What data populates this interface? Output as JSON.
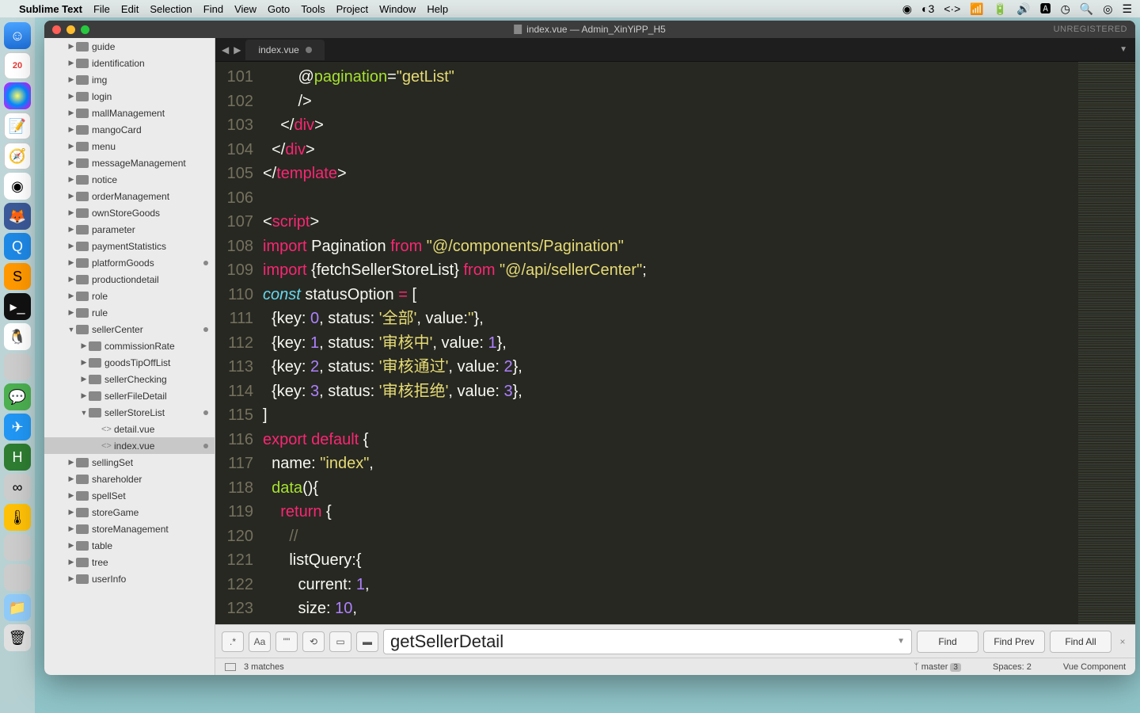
{
  "menubar": {
    "app": "Sublime Text",
    "items": [
      "File",
      "Edit",
      "Selection",
      "Find",
      "View",
      "Goto",
      "Tools",
      "Project",
      "Window",
      "Help"
    ],
    "right_status_num": "3"
  },
  "dock": {
    "calendar_day": "20"
  },
  "window": {
    "title": "index.vue — Admin_XinYiPP_H5",
    "unregistered": "UNREGISTERED"
  },
  "sidebar": {
    "items": [
      {
        "name": "guide",
        "depth": 1,
        "type": "folder",
        "arrow": "▶"
      },
      {
        "name": "identification",
        "depth": 1,
        "type": "folder",
        "arrow": "▶"
      },
      {
        "name": "img",
        "depth": 1,
        "type": "folder",
        "arrow": "▶"
      },
      {
        "name": "login",
        "depth": 1,
        "type": "folder",
        "arrow": "▶"
      },
      {
        "name": "mallManagement",
        "depth": 1,
        "type": "folder",
        "arrow": "▶"
      },
      {
        "name": "mangoCard",
        "depth": 1,
        "type": "folder",
        "arrow": "▶"
      },
      {
        "name": "menu",
        "depth": 1,
        "type": "folder",
        "arrow": "▶"
      },
      {
        "name": "messageManagement",
        "depth": 1,
        "type": "folder",
        "arrow": "▶"
      },
      {
        "name": "notice",
        "depth": 1,
        "type": "folder",
        "arrow": "▶"
      },
      {
        "name": "orderManagement",
        "depth": 1,
        "type": "folder",
        "arrow": "▶"
      },
      {
        "name": "ownStoreGoods",
        "depth": 1,
        "type": "folder",
        "arrow": "▶"
      },
      {
        "name": "parameter",
        "depth": 1,
        "type": "folder",
        "arrow": "▶"
      },
      {
        "name": "paymentStatistics",
        "depth": 1,
        "type": "folder",
        "arrow": "▶"
      },
      {
        "name": "platformGoods",
        "depth": 1,
        "type": "folder",
        "arrow": "▶",
        "dot": true
      },
      {
        "name": "productiondetail",
        "depth": 1,
        "type": "folder",
        "arrow": "▶"
      },
      {
        "name": "role",
        "depth": 1,
        "type": "folder",
        "arrow": "▶"
      },
      {
        "name": "rule",
        "depth": 1,
        "type": "folder",
        "arrow": "▶"
      },
      {
        "name": "sellerCenter",
        "depth": 1,
        "type": "folder",
        "arrow": "▼",
        "dot": true
      },
      {
        "name": "commissionRate",
        "depth": 2,
        "type": "folder",
        "arrow": "▶"
      },
      {
        "name": "goodsTipOffList",
        "depth": 2,
        "type": "folder",
        "arrow": "▶"
      },
      {
        "name": "sellerChecking",
        "depth": 2,
        "type": "folder",
        "arrow": "▶"
      },
      {
        "name": "sellerFileDetail",
        "depth": 2,
        "type": "folder",
        "arrow": "▶"
      },
      {
        "name": "sellerStoreList",
        "depth": 2,
        "type": "folder",
        "arrow": "▼",
        "dot": true
      },
      {
        "name": "detail.vue",
        "depth": 3,
        "type": "file"
      },
      {
        "name": "index.vue",
        "depth": 3,
        "type": "file",
        "selected": true,
        "dot": true
      },
      {
        "name": "sellingSet",
        "depth": 1,
        "type": "folder",
        "arrow": "▶"
      },
      {
        "name": "shareholder",
        "depth": 1,
        "type": "folder",
        "arrow": "▶"
      },
      {
        "name": "spellSet",
        "depth": 1,
        "type": "folder",
        "arrow": "▶"
      },
      {
        "name": "storeGame",
        "depth": 1,
        "type": "folder",
        "arrow": "▶"
      },
      {
        "name": "storeManagement",
        "depth": 1,
        "type": "folder",
        "arrow": "▶"
      },
      {
        "name": "table",
        "depth": 1,
        "type": "folder",
        "arrow": "▶"
      },
      {
        "name": "tree",
        "depth": 1,
        "type": "folder",
        "arrow": "▶"
      },
      {
        "name": "userInfo",
        "depth": 1,
        "type": "folder",
        "arrow": "▶"
      }
    ]
  },
  "tab": {
    "name": "index.vue"
  },
  "code": {
    "lines": [
      {
        "n": 101,
        "html": "        <span class='k-white'>@</span><span class='k-green'>pagination</span><span class='k-white'>=</span><span class='k-yellow'>\"getList\"</span>"
      },
      {
        "n": 102,
        "html": "        <span class='k-white'>/&gt;</span>"
      },
      {
        "n": 103,
        "html": "    <span class='k-white'>&lt;/</span><span class='k-red'>div</span><span class='k-white'>&gt;</span>"
      },
      {
        "n": 104,
        "html": "  <span class='k-white'>&lt;/</span><span class='k-red'>div</span><span class='k-white'>&gt;</span>"
      },
      {
        "n": 105,
        "html": "<span class='k-white'>&lt;/</span><span class='k-red'>template</span><span class='k-white'>&gt;</span>"
      },
      {
        "n": 106,
        "html": ""
      },
      {
        "n": 107,
        "html": "<span class='k-white'>&lt;</span><span class='k-red'>script</span><span class='k-white'>&gt;</span>"
      },
      {
        "n": 108,
        "html": "<span class='k-red'>import</span> <span class='k-white'>Pagination</span> <span class='k-red'>from</span> <span class='k-yellow'>\"@/components/Pagination\"</span>"
      },
      {
        "n": 109,
        "html": "<span class='k-red'>import</span> <span class='k-white'>{fetchSellerStoreList}</span> <span class='k-red'>from</span> <span class='k-yellow'>\"@/api/sellerCenter\"</span><span class='k-white'>;</span>"
      },
      {
        "n": 110,
        "html": "<span class='k-blue'>const</span> <span class='k-white'>statusOption</span> <span class='k-red'>=</span> <span class='k-white'>[</span>"
      },
      {
        "n": 111,
        "html": "  <span class='k-white'>{key:</span> <span class='k-purple'>0</span><span class='k-white'>, status:</span> <span class='k-yellow'>'全部'</span><span class='k-white'>, value:</span><span class='k-yellow'>''</span><span class='k-white'>},</span>"
      },
      {
        "n": 112,
        "html": "  <span class='k-white'>{key:</span> <span class='k-purple'>1</span><span class='k-white'>, status:</span> <span class='k-yellow'>'审核中'</span><span class='k-white'>, value:</span> <span class='k-purple'>1</span><span class='k-white'>},</span>"
      },
      {
        "n": 113,
        "html": "  <span class='k-white'>{key:</span> <span class='k-purple'>2</span><span class='k-white'>, status:</span> <span class='k-yellow'>'审核通过'</span><span class='k-white'>, value:</span> <span class='k-purple'>2</span><span class='k-white'>},</span>"
      },
      {
        "n": 114,
        "html": "  <span class='k-white'>{key:</span> <span class='k-purple'>3</span><span class='k-white'>, status:</span> <span class='k-yellow'>'审核拒绝'</span><span class='k-white'>, value:</span> <span class='k-purple'>3</span><span class='k-white'>},</span>"
      },
      {
        "n": 115,
        "html": "<span class='k-white'>]</span>"
      },
      {
        "n": 116,
        "html": "<span class='k-red'>export</span> <span class='k-red'>default</span> <span class='k-white'>{</span>"
      },
      {
        "n": 117,
        "html": "  <span class='k-white'>name:</span> <span class='k-yellow'>\"index\"</span><span class='k-white'>,</span>"
      },
      {
        "n": 118,
        "html": "  <span class='k-green'>data</span><span class='k-white'>(){</span>"
      },
      {
        "n": 119,
        "html": "    <span class='k-red'>return</span> <span class='k-white'>{</span>"
      },
      {
        "n": 120,
        "html": "      <span class='k-comment'>//</span>"
      },
      {
        "n": 121,
        "html": "      <span class='k-white'>listQuery:{</span>"
      },
      {
        "n": 122,
        "html": "        <span class='k-white'>current:</span> <span class='k-purple'>1</span><span class='k-white'>,</span>"
      },
      {
        "n": 123,
        "html": "        <span class='k-white'>size:</span> <span class='k-purple'>10</span><span class='k-white'>,</span>"
      }
    ]
  },
  "find": {
    "value": "getSellerDetail",
    "btn_find": "Find",
    "btn_prev": "Find Prev",
    "btn_all": "Find All",
    "matches": "3 matches"
  },
  "status": {
    "branch": "master",
    "branch_num": "3",
    "spaces": "Spaces: 2",
    "syntax": "Vue Component"
  }
}
